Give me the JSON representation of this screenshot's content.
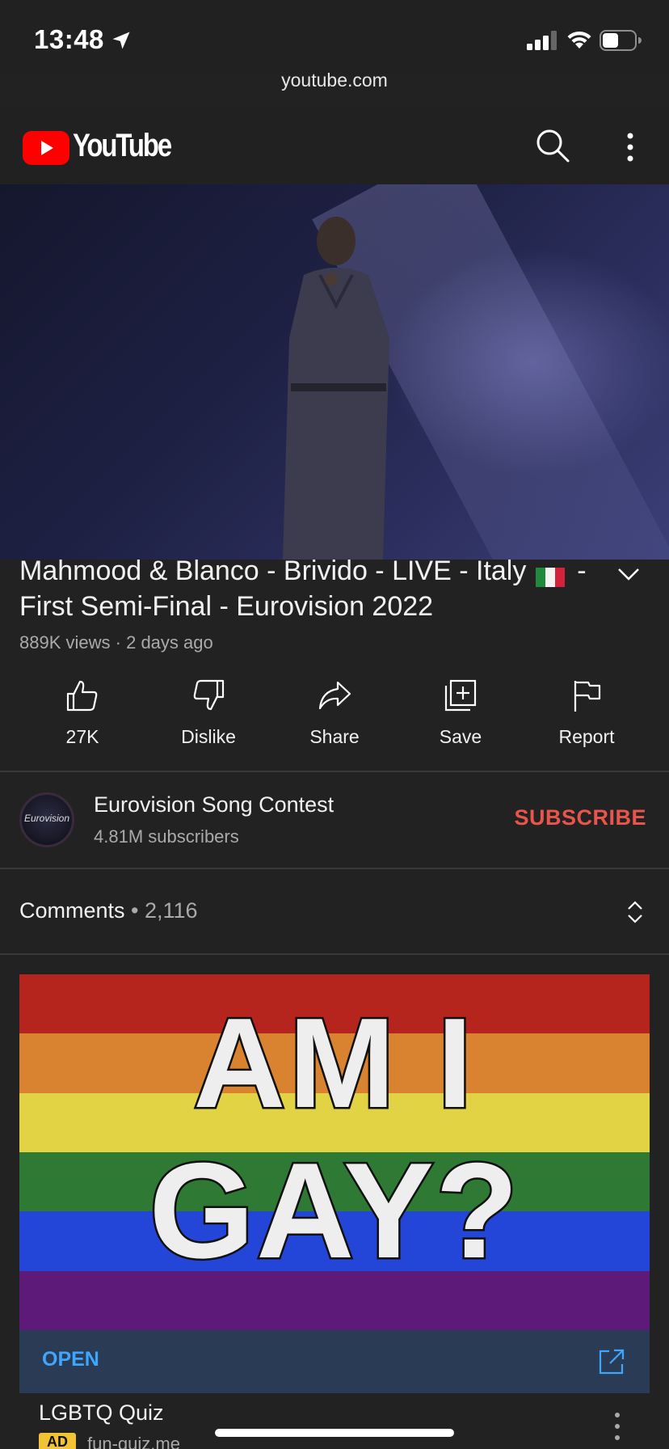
{
  "status_bar": {
    "time": "13:48",
    "battery_level": 0.5
  },
  "browser": {
    "url": "youtube.com"
  },
  "header": {
    "logo_text": "YouTube"
  },
  "video": {
    "title": "Mahmood & Blanco - Brivido - LIVE - Italy",
    "title_part2": "- First Semi-Final - Eurovision 2022",
    "views": "889K views",
    "age": "2 days ago",
    "meta_separator": "·"
  },
  "actions": {
    "like": "27K",
    "dislike": "Dislike",
    "share": "Share",
    "save": "Save",
    "report": "Report"
  },
  "channel": {
    "name": "Eurovision Song Contest",
    "subscribers": "4.81M subscribers",
    "avatar_text": "Eurovision",
    "subscribe": "SUBSCRIBE"
  },
  "comments": {
    "label": "Comments",
    "count": "• 2,116"
  },
  "ad": {
    "image_line1": "AM I",
    "image_line2": "GAY?",
    "open_label": "OPEN",
    "title": "LGBTQ Quiz",
    "badge": "AD",
    "domain": "fun-quiz.me",
    "stripe_colors": [
      "#b5251d",
      "#d9822f",
      "#e2d344",
      "#2e7a34",
      "#2346d8",
      "#5e1a78"
    ]
  },
  "colors": {
    "accent_red": "#e9544b",
    "link_blue": "#3ea6ff",
    "background": "#222222"
  }
}
